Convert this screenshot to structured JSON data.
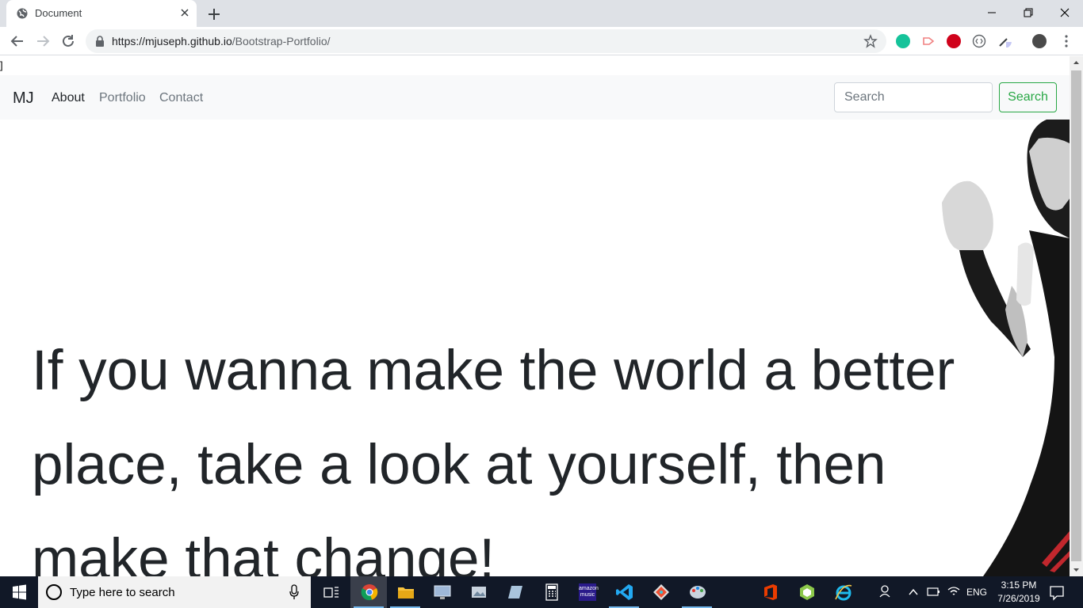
{
  "browser": {
    "tab_title": "Document",
    "url_host": "https://mjuseph.github.io",
    "url_path": "/Bootstrap-Portfolio/"
  },
  "page": {
    "stray_char": "]",
    "brand": "MJ",
    "nav": [
      "About",
      "Portfolio",
      "Contact"
    ],
    "search_placeholder": "Search",
    "search_button": "Search",
    "quote": "If you wanna make the world a better place, take a look at yourself, then make that change!"
  },
  "taskbar": {
    "search_placeholder": "Type here to search",
    "amazon_label": "amazon music",
    "language": "ENG",
    "time": "3:15 PM",
    "date": "7/26/2019"
  },
  "colors": {
    "accent_green": "#28a745",
    "text_dark": "#212529",
    "nav_muted": "#6c757d",
    "navbar_bg": "#f8f9fa",
    "taskbar_bg": "#111827"
  }
}
